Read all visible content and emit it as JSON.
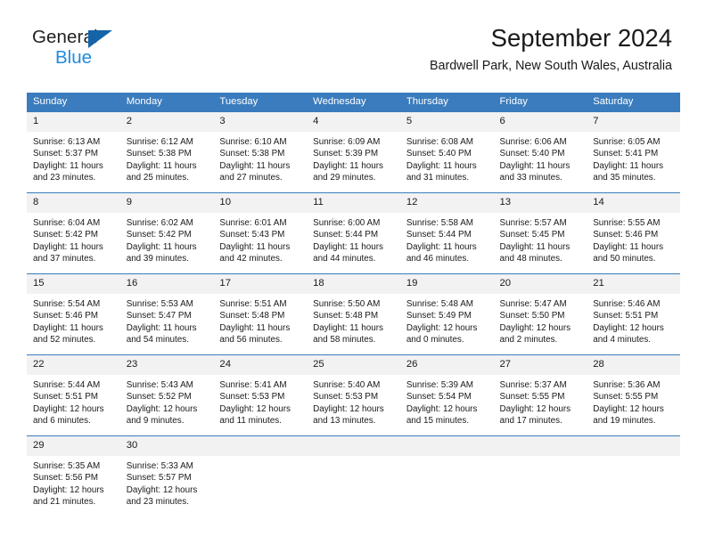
{
  "brand": {
    "name_top": "General",
    "name_bottom": "Blue",
    "triangle_color": "#1464aa",
    "blue_color": "#1E8BE0"
  },
  "header": {
    "title": "September 2024",
    "location": "Bardwell Park, New South Wales, Australia"
  },
  "theme": {
    "header_blue": "#3a7cbe",
    "daynum_band": "#f2f2f2",
    "text": "#1a1a1a"
  },
  "weekdays": [
    "Sunday",
    "Monday",
    "Tuesday",
    "Wednesday",
    "Thursday",
    "Friday",
    "Saturday"
  ],
  "weeks": [
    [
      {
        "day": "1",
        "sunrise": "Sunrise: 6:13 AM",
        "sunset": "Sunset: 5:37 PM",
        "daylight": "Daylight: 11 hours and 23 minutes."
      },
      {
        "day": "2",
        "sunrise": "Sunrise: 6:12 AM",
        "sunset": "Sunset: 5:38 PM",
        "daylight": "Daylight: 11 hours and 25 minutes."
      },
      {
        "day": "3",
        "sunrise": "Sunrise: 6:10 AM",
        "sunset": "Sunset: 5:38 PM",
        "daylight": "Daylight: 11 hours and 27 minutes."
      },
      {
        "day": "4",
        "sunrise": "Sunrise: 6:09 AM",
        "sunset": "Sunset: 5:39 PM",
        "daylight": "Daylight: 11 hours and 29 minutes."
      },
      {
        "day": "5",
        "sunrise": "Sunrise: 6:08 AM",
        "sunset": "Sunset: 5:40 PM",
        "daylight": "Daylight: 11 hours and 31 minutes."
      },
      {
        "day": "6",
        "sunrise": "Sunrise: 6:06 AM",
        "sunset": "Sunset: 5:40 PM",
        "daylight": "Daylight: 11 hours and 33 minutes."
      },
      {
        "day": "7",
        "sunrise": "Sunrise: 6:05 AM",
        "sunset": "Sunset: 5:41 PM",
        "daylight": "Daylight: 11 hours and 35 minutes."
      }
    ],
    [
      {
        "day": "8",
        "sunrise": "Sunrise: 6:04 AM",
        "sunset": "Sunset: 5:42 PM",
        "daylight": "Daylight: 11 hours and 37 minutes."
      },
      {
        "day": "9",
        "sunrise": "Sunrise: 6:02 AM",
        "sunset": "Sunset: 5:42 PM",
        "daylight": "Daylight: 11 hours and 39 minutes."
      },
      {
        "day": "10",
        "sunrise": "Sunrise: 6:01 AM",
        "sunset": "Sunset: 5:43 PM",
        "daylight": "Daylight: 11 hours and 42 minutes."
      },
      {
        "day": "11",
        "sunrise": "Sunrise: 6:00 AM",
        "sunset": "Sunset: 5:44 PM",
        "daylight": "Daylight: 11 hours and 44 minutes."
      },
      {
        "day": "12",
        "sunrise": "Sunrise: 5:58 AM",
        "sunset": "Sunset: 5:44 PM",
        "daylight": "Daylight: 11 hours and 46 minutes."
      },
      {
        "day": "13",
        "sunrise": "Sunrise: 5:57 AM",
        "sunset": "Sunset: 5:45 PM",
        "daylight": "Daylight: 11 hours and 48 minutes."
      },
      {
        "day": "14",
        "sunrise": "Sunrise: 5:55 AM",
        "sunset": "Sunset: 5:46 PM",
        "daylight": "Daylight: 11 hours and 50 minutes."
      }
    ],
    [
      {
        "day": "15",
        "sunrise": "Sunrise: 5:54 AM",
        "sunset": "Sunset: 5:46 PM",
        "daylight": "Daylight: 11 hours and 52 minutes."
      },
      {
        "day": "16",
        "sunrise": "Sunrise: 5:53 AM",
        "sunset": "Sunset: 5:47 PM",
        "daylight": "Daylight: 11 hours and 54 minutes."
      },
      {
        "day": "17",
        "sunrise": "Sunrise: 5:51 AM",
        "sunset": "Sunset: 5:48 PM",
        "daylight": "Daylight: 11 hours and 56 minutes."
      },
      {
        "day": "18",
        "sunrise": "Sunrise: 5:50 AM",
        "sunset": "Sunset: 5:48 PM",
        "daylight": "Daylight: 11 hours and 58 minutes."
      },
      {
        "day": "19",
        "sunrise": "Sunrise: 5:48 AM",
        "sunset": "Sunset: 5:49 PM",
        "daylight": "Daylight: 12 hours and 0 minutes."
      },
      {
        "day": "20",
        "sunrise": "Sunrise: 5:47 AM",
        "sunset": "Sunset: 5:50 PM",
        "daylight": "Daylight: 12 hours and 2 minutes."
      },
      {
        "day": "21",
        "sunrise": "Sunrise: 5:46 AM",
        "sunset": "Sunset: 5:51 PM",
        "daylight": "Daylight: 12 hours and 4 minutes."
      }
    ],
    [
      {
        "day": "22",
        "sunrise": "Sunrise: 5:44 AM",
        "sunset": "Sunset: 5:51 PM",
        "daylight": "Daylight: 12 hours and 6 minutes."
      },
      {
        "day": "23",
        "sunrise": "Sunrise: 5:43 AM",
        "sunset": "Sunset: 5:52 PM",
        "daylight": "Daylight: 12 hours and 9 minutes."
      },
      {
        "day": "24",
        "sunrise": "Sunrise: 5:41 AM",
        "sunset": "Sunset: 5:53 PM",
        "daylight": "Daylight: 12 hours and 11 minutes."
      },
      {
        "day": "25",
        "sunrise": "Sunrise: 5:40 AM",
        "sunset": "Sunset: 5:53 PM",
        "daylight": "Daylight: 12 hours and 13 minutes."
      },
      {
        "day": "26",
        "sunrise": "Sunrise: 5:39 AM",
        "sunset": "Sunset: 5:54 PM",
        "daylight": "Daylight: 12 hours and 15 minutes."
      },
      {
        "day": "27",
        "sunrise": "Sunrise: 5:37 AM",
        "sunset": "Sunset: 5:55 PM",
        "daylight": "Daylight: 12 hours and 17 minutes."
      },
      {
        "day": "28",
        "sunrise": "Sunrise: 5:36 AM",
        "sunset": "Sunset: 5:55 PM",
        "daylight": "Daylight: 12 hours and 19 minutes."
      }
    ],
    [
      {
        "day": "29",
        "sunrise": "Sunrise: 5:35 AM",
        "sunset": "Sunset: 5:56 PM",
        "daylight": "Daylight: 12 hours and 21 minutes."
      },
      {
        "day": "30",
        "sunrise": "Sunrise: 5:33 AM",
        "sunset": "Sunset: 5:57 PM",
        "daylight": "Daylight: 12 hours and 23 minutes."
      },
      {
        "day": "",
        "sunrise": "",
        "sunset": "",
        "daylight": ""
      },
      {
        "day": "",
        "sunrise": "",
        "sunset": "",
        "daylight": ""
      },
      {
        "day": "",
        "sunrise": "",
        "sunset": "",
        "daylight": ""
      },
      {
        "day": "",
        "sunrise": "",
        "sunset": "",
        "daylight": ""
      },
      {
        "day": "",
        "sunrise": "",
        "sunset": "",
        "daylight": ""
      }
    ]
  ]
}
